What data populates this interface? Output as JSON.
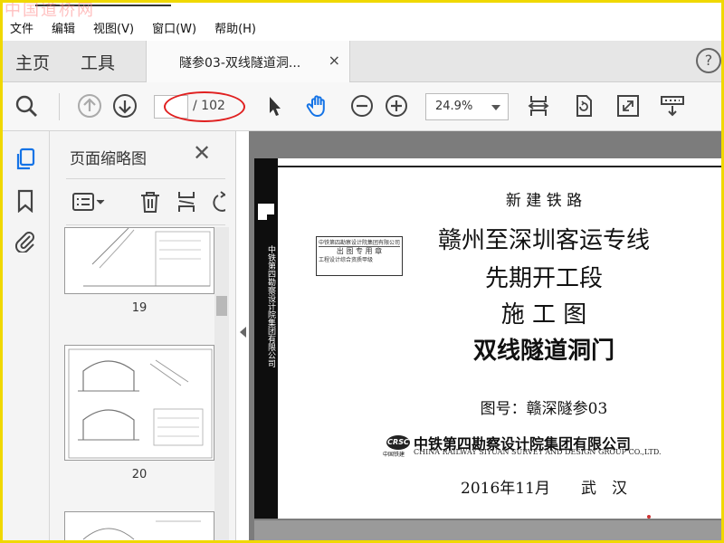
{
  "watermark": "中国道桥网",
  "menu": [
    "文件",
    "编辑",
    "视图(V)",
    "窗口(W)",
    "帮助(H)"
  ],
  "nav_tabs": {
    "home": "主页",
    "tools": "工具"
  },
  "document_tab": {
    "label": "隧参03-双线隧道洞...",
    "close": "×"
  },
  "toolbar": {
    "page_total": "/ 102",
    "zoom": "24.9%"
  },
  "panel": {
    "title": "页面缩略图",
    "close": "✕",
    "thumbnails": [
      {
        "label": "19"
      },
      {
        "label": "20"
      }
    ]
  },
  "document": {
    "line1": "新 建 铁 路",
    "line2": "赣州至深圳客运专线",
    "line3": "先期开工段",
    "line4": "施 工 图",
    "line5": "双线隧道洞门",
    "drawing_no": "图号：赣深隧参03",
    "company_cn": "中铁第四勘察设计院集团有限公司",
    "company_en": "CHINA RAILWAY SIYUAN SURVEY AND DESIGN GROUP CO.,LTD.",
    "date_place": "2016年11月　　武　汉",
    "side_text": "中铁第四勘察设计院集团有限公司",
    "stamp_text": "出 图 专 用 章",
    "logo_text": "CRSC",
    "logo_sub": "中国铁建"
  }
}
